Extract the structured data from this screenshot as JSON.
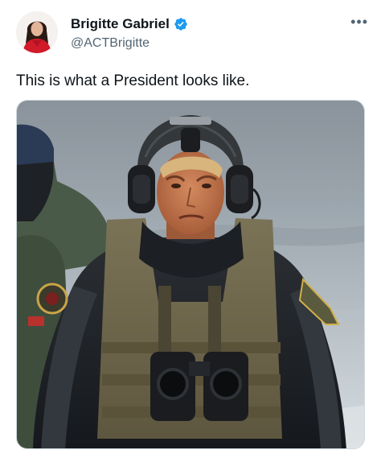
{
  "tweet": {
    "author": {
      "name": "Brigitte Gabriel",
      "handle": "@ACTBrigitte",
      "verified": true
    },
    "more_label": "•••",
    "text": "This is what a President looks like.",
    "media": {
      "alt": "Man in tactical gear with helmet and headset standing in front of water"
    }
  },
  "colors": {
    "verified_badge": "#1d9bf0",
    "secondary_text": "#536471",
    "primary_text": "#0f1419"
  }
}
